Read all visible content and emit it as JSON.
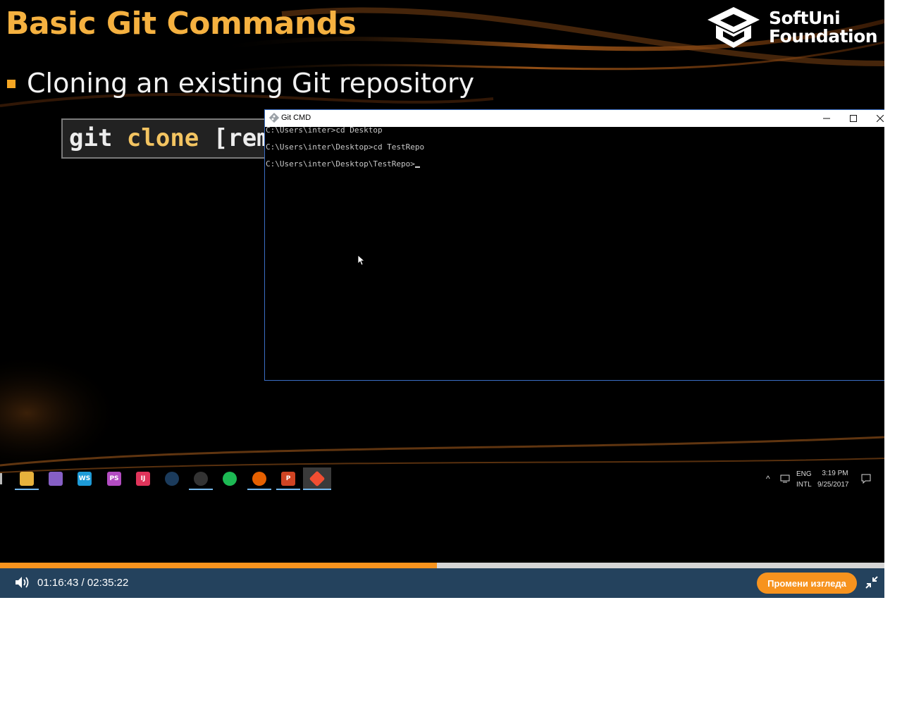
{
  "slide": {
    "title": "Basic Git Commands",
    "logo_line1": "SoftUni",
    "logo_line2": "Foundation",
    "bullet": "Cloning an existing Git repository",
    "code_kw1": "git",
    "code_kw2": "clone",
    "code_rest": "[rem"
  },
  "cmd_window": {
    "title": "Git CMD",
    "lines": [
      "C:\\Users\\inter>cd Desktop",
      "C:\\Users\\inter\\Desktop>cd TestRepo",
      "C:\\Users\\inter\\Desktop\\TestRepo>"
    ]
  },
  "taskbar": {
    "apps": [
      {
        "icon": "file-explorer-icon",
        "label": "",
        "color": "#e8b23c",
        "running": true
      },
      {
        "icon": "visual-studio-icon",
        "label": "",
        "color": "#865fc5",
        "running": false
      },
      {
        "icon": "webstorm-icon",
        "label": "WS",
        "color": "#1d9bd8",
        "running": false
      },
      {
        "icon": "phpstorm-icon",
        "label": "PS",
        "color": "#b34cc2",
        "running": false
      },
      {
        "icon": "intellij-icon",
        "label": "IJ",
        "color": "#e0345a",
        "running": false
      },
      {
        "icon": "steam-icon",
        "label": "",
        "color": "#1b3b5c",
        "running": false
      },
      {
        "icon": "obs-icon",
        "label": "",
        "color": "#333333",
        "running": true
      },
      {
        "icon": "spotify-icon",
        "label": "",
        "color": "#1db954",
        "running": false
      },
      {
        "icon": "firefox-icon",
        "label": "",
        "color": "#e66000",
        "running": true
      },
      {
        "icon": "powerpoint-icon",
        "label": "P",
        "color": "#d04423",
        "running": true
      },
      {
        "icon": "git-icon",
        "label": "",
        "color": "#f14e32",
        "running": true
      }
    ],
    "tray": {
      "lang1": "ENG",
      "lang2": "INTL",
      "time": "3:19 PM",
      "date": "9/25/2017"
    }
  },
  "player": {
    "time_display": "01:16:43 / 02:35:22",
    "progress_fraction": 0.4938,
    "change_view_label": "Промени изгледа",
    "accent_color": "#f7931e",
    "bar_color": "#24425d"
  }
}
